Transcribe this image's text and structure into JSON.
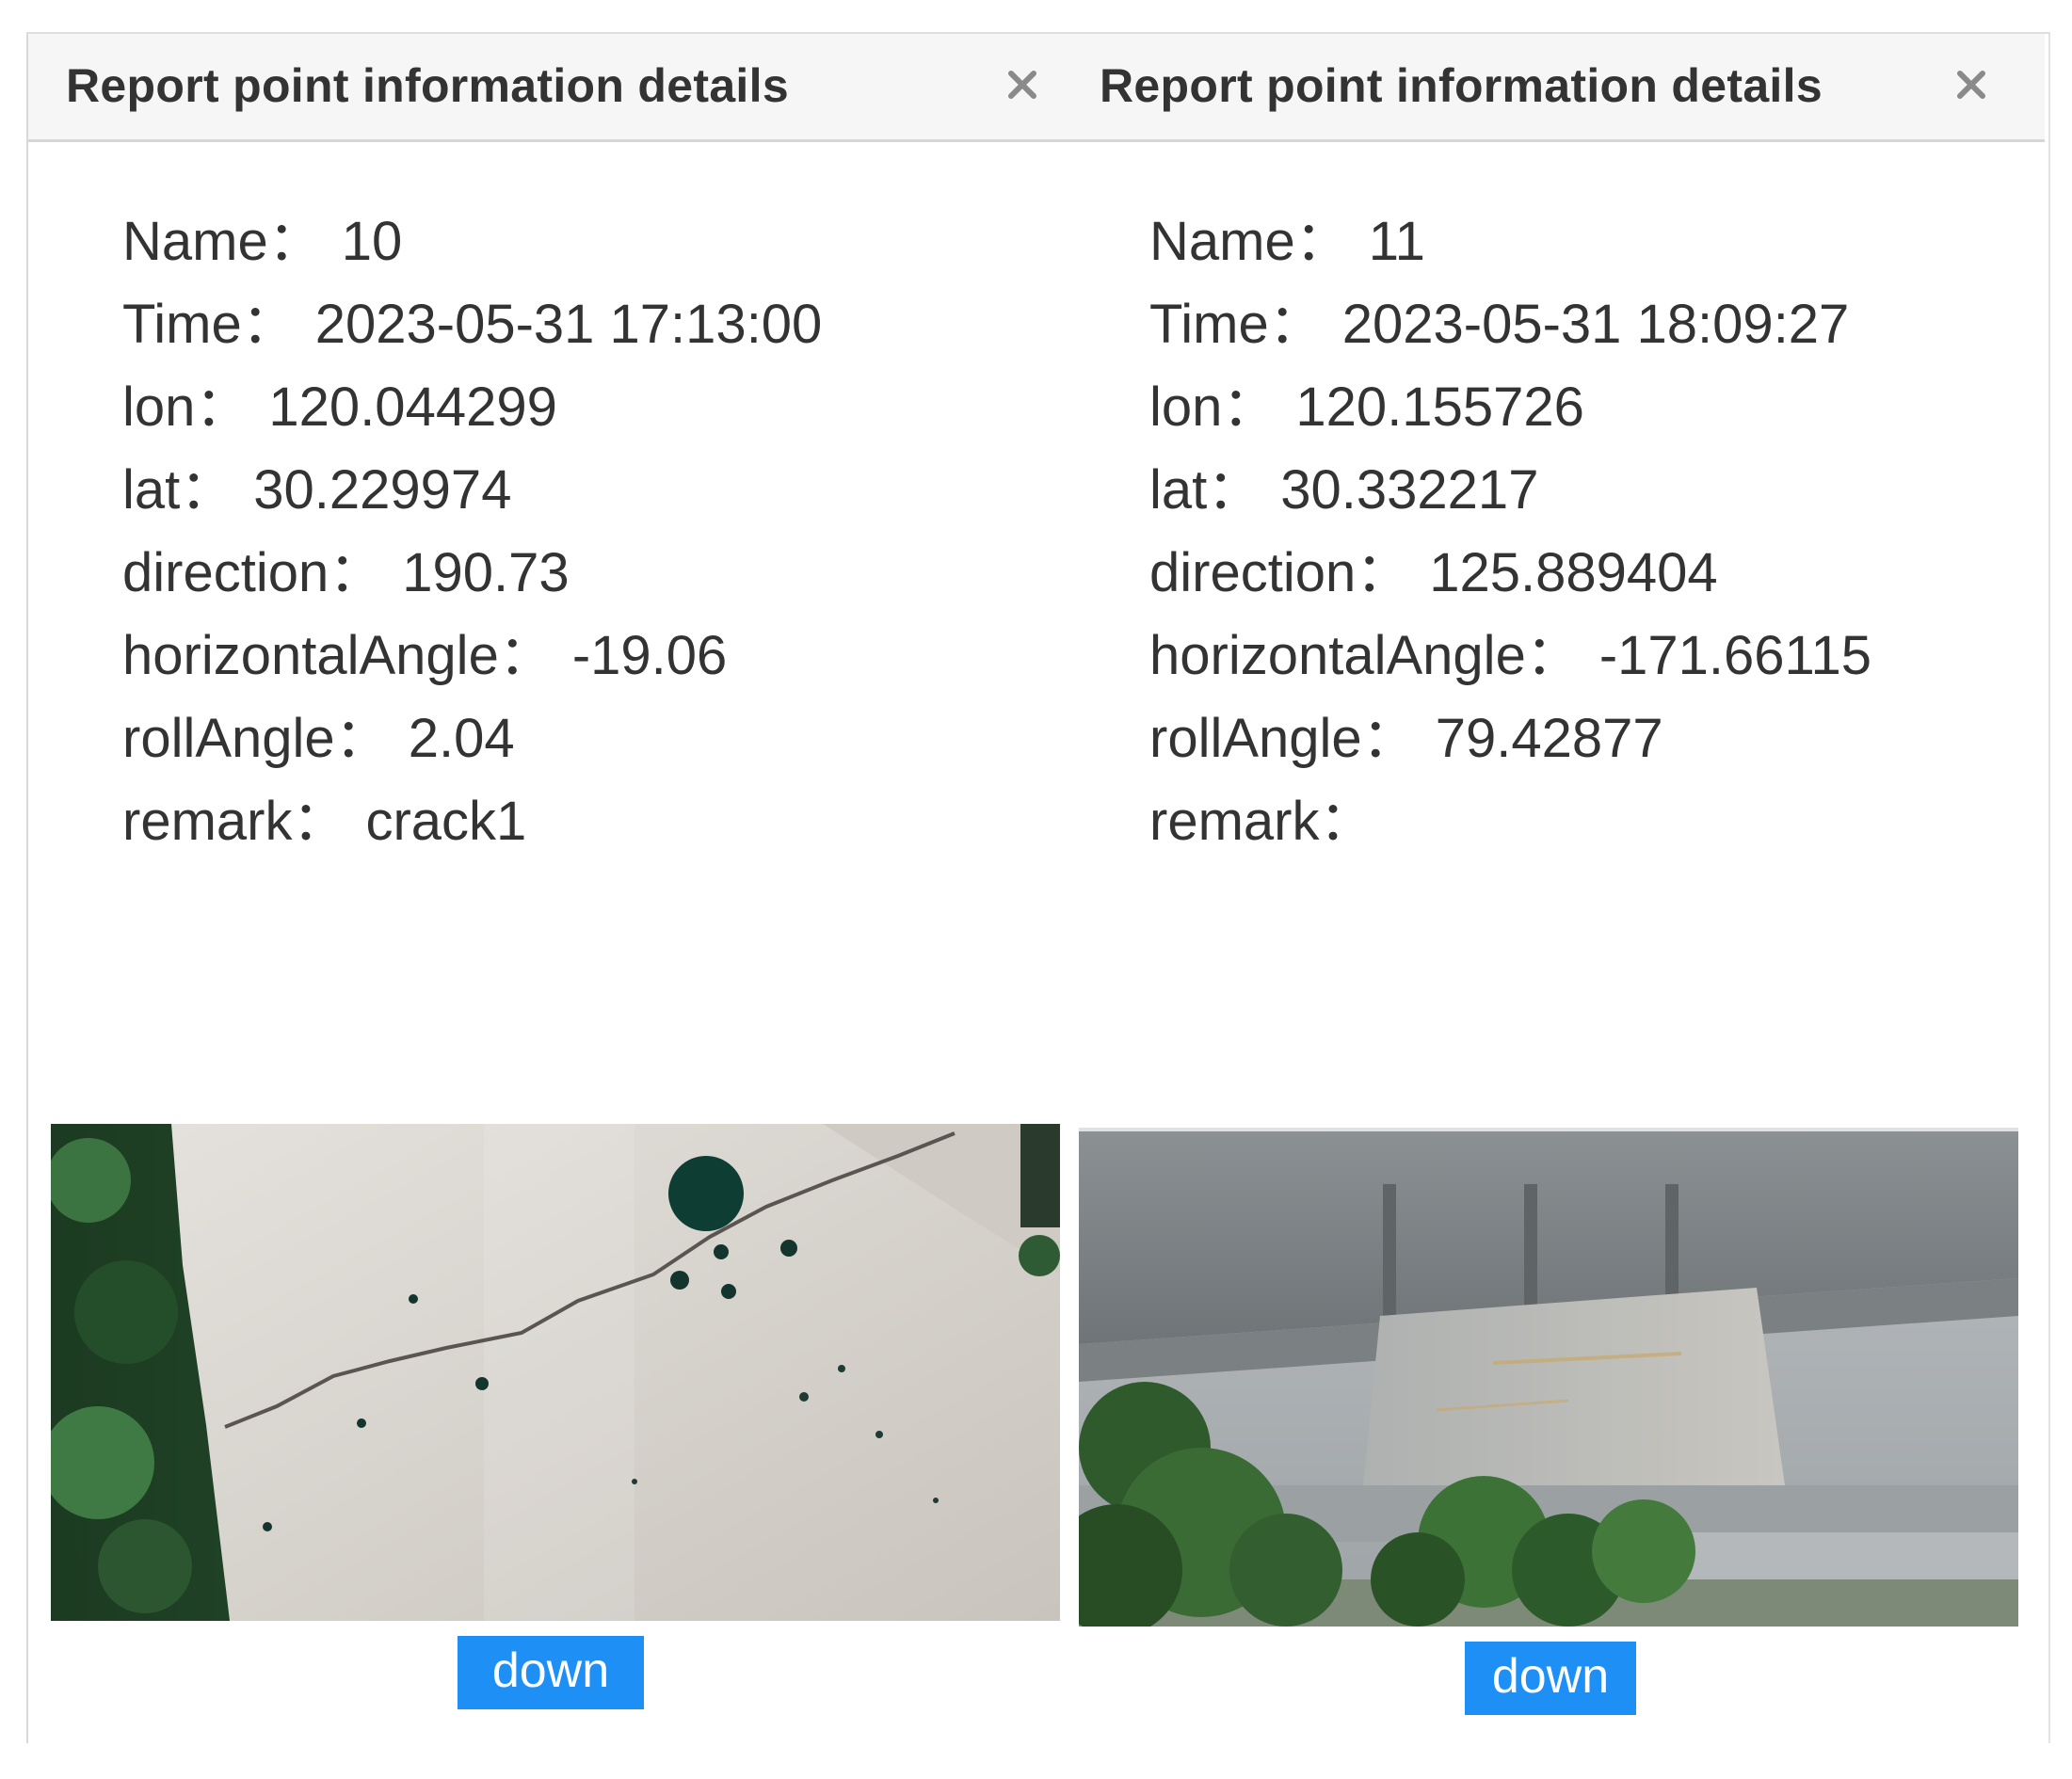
{
  "panels": [
    {
      "title": "Report point information details",
      "fields": [
        {
          "label": "Name",
          "value": "10"
        },
        {
          "label": "Time",
          "value": "2023-05-31 17:13:00"
        },
        {
          "label": "lon",
          "value": "120.044299"
        },
        {
          "label": "lat",
          "value": "30.229974"
        },
        {
          "label": "direction",
          "value": "190.73"
        },
        {
          "label": "horizontalAngle",
          "value": "-19.06"
        },
        {
          "label": "rollAngle",
          "value": "2.04"
        },
        {
          "label": "remark",
          "value": "crack1"
        }
      ],
      "separator": "：",
      "close_icon": "close-icon",
      "photo_subject": "concrete crack",
      "down_label": "down"
    },
    {
      "title": "Report point information details",
      "fields": [
        {
          "label": "Name",
          "value": "11"
        },
        {
          "label": "Time",
          "value": "2023-05-31 18:09:27"
        },
        {
          "label": "lon",
          "value": "120.155726"
        },
        {
          "label": "lat",
          "value": "30.332217"
        },
        {
          "label": "direction",
          "value": "125.889404"
        },
        {
          "label": "horizontalAngle",
          "value": "-171.66115"
        },
        {
          "label": "rollAngle",
          "value": "79.42877"
        },
        {
          "label": "remark",
          "value": ""
        }
      ],
      "separator": "：",
      "close_icon": "close-icon",
      "photo_subject": "bridge pier",
      "down_label": "down"
    }
  ],
  "colors": {
    "header_bg": "#f6f6f6",
    "title_text": "#333333",
    "field_text": "#333333",
    "button_bg": "#1e90f5",
    "button_text": "#ffffff",
    "close_icon": "#8a8a8a"
  }
}
